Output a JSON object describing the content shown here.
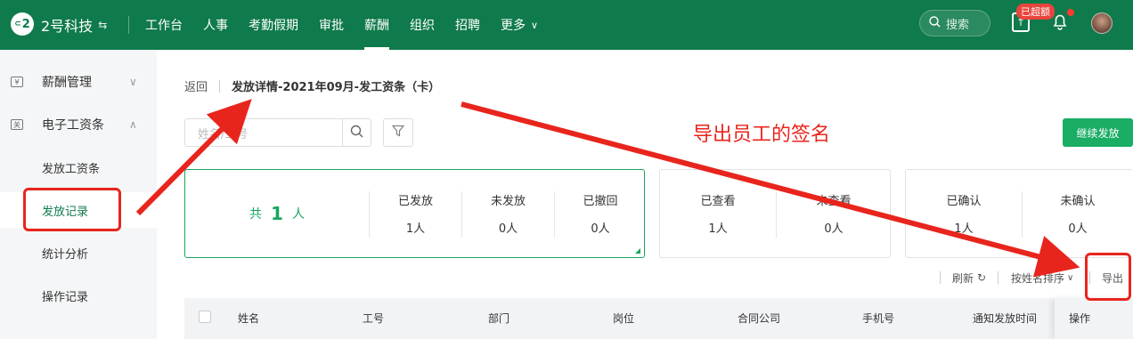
{
  "header": {
    "logo_text": "2",
    "company_name": "2号科技",
    "nav": [
      {
        "label": "工作台",
        "active": false
      },
      {
        "label": "人事",
        "active": false
      },
      {
        "label": "考勤假期",
        "active": false
      },
      {
        "label": "审批",
        "active": false
      },
      {
        "label": "薪酬",
        "active": true
      },
      {
        "label": "组织",
        "active": false
      },
      {
        "label": "招聘",
        "active": false
      },
      {
        "label": "更多",
        "active": false
      }
    ],
    "search_placeholder": "搜索",
    "upload_badge": "已超额"
  },
  "sidebar": {
    "groups": [
      {
        "label": "薪酬管理",
        "icon": "yen-icon",
        "expanded": false
      },
      {
        "label": "电子工资条",
        "icon": "document-icon",
        "expanded": true
      }
    ],
    "items": [
      {
        "label": "发放工资条",
        "active": false
      },
      {
        "label": "发放记录",
        "active": true
      },
      {
        "label": "统计分析",
        "active": false
      },
      {
        "label": "操作记录",
        "active": false
      }
    ]
  },
  "page": {
    "back_label": "返回",
    "title": "发放详情-2021年09月-发工资条（卡）",
    "search_placeholder": "姓名/工号",
    "continue_button": "继续发放",
    "annotation": "导出员工的签名"
  },
  "stats": {
    "total_prefix": "共",
    "total_count": "1",
    "total_suffix": "人",
    "group1": [
      {
        "label": "已发放",
        "value": "1人"
      },
      {
        "label": "未发放",
        "value": "0人"
      },
      {
        "label": "已撤回",
        "value": "0人"
      }
    ],
    "group2": [
      {
        "label": "已查看",
        "value": "1人"
      },
      {
        "label": "未查看",
        "value": "0人"
      }
    ],
    "group3": [
      {
        "label": "已确认",
        "value": "1人"
      },
      {
        "label": "未确认",
        "value": "0人"
      }
    ]
  },
  "toolbar": {
    "refresh": "刷新",
    "sort": "按姓名排序",
    "export": "导出"
  },
  "table": {
    "columns": [
      "姓名",
      "工号",
      "部门",
      "岗位",
      "合同公司",
      "手机号",
      "通知发放时间",
      "操作"
    ]
  },
  "colors": {
    "brand": "#0f7a4b",
    "accent": "#18a660",
    "annotation": "#e8251d"
  }
}
